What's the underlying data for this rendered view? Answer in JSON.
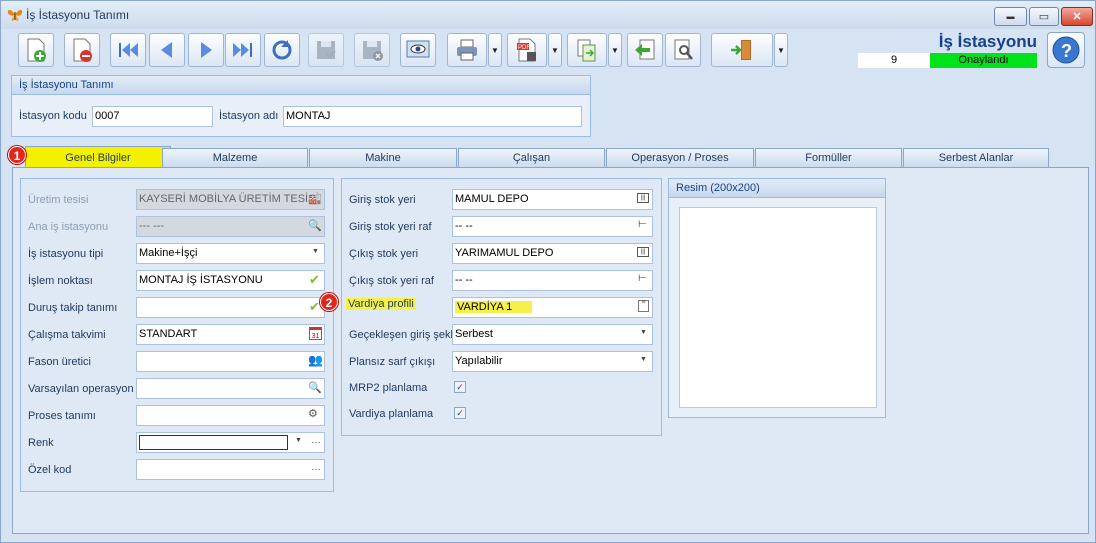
{
  "window": {
    "title": "İş İstasyonu Tanımı",
    "controls": {
      "minimize": "▬",
      "maximize": "▭",
      "close": "✕"
    }
  },
  "header": {
    "title": "İş İstasyonu Tanımı",
    "record_number": "9",
    "status": "Onaylandı",
    "status_color": "#00e21a"
  },
  "toolbar": {
    "icons": [
      "new-record-icon",
      "delete-record-icon",
      "first-record-icon",
      "previous-record-icon",
      "next-record-icon",
      "last-record-icon",
      "refresh-icon",
      "save-icon",
      "save-cancel-icon",
      "preview-icon",
      "print-icon",
      "pdf-export-icon",
      "export-icon",
      "back-icon",
      "tools-icon",
      "exit-icon"
    ]
  },
  "station": {
    "group_title": "İş İstasyonu Tanımı",
    "code_label": "İstasyon kodu",
    "code_value": "0007",
    "name_label": "İstasyon adı",
    "name_value": "MONTAJ"
  },
  "tabs": [
    {
      "label": "Genel Bilgiler",
      "active": true
    },
    {
      "label": "Malzeme"
    },
    {
      "label": "Makine"
    },
    {
      "label": "Çalışan"
    },
    {
      "label": "Operasyon / Proses"
    },
    {
      "label": "Formüller"
    },
    {
      "label": "Serbest Alanlar"
    }
  ],
  "badges": {
    "one": "1",
    "two": "2"
  },
  "left_panel": {
    "uretim_tesisi": {
      "label": "Üretim tesisi",
      "value": "KAYSERİ MOBİLYA ÜRETİM TESİSİ"
    },
    "ana_is_istasyonu": {
      "label": "Ana iş istasyonu",
      "value": "--- ---"
    },
    "is_istasyonu_tipi": {
      "label": "İş istasyonu tipi",
      "value": "Makine+İşçi"
    },
    "islem_noktasi": {
      "label": "İşlem noktası",
      "value": "MONTAJ İŞ İSTASYONU"
    },
    "durus_takip": {
      "label": "Duruş takip tanımı",
      "value": ""
    },
    "calisma_takvimi": {
      "label": "Çalışma takvimi",
      "value": "STANDART"
    },
    "fason_uretici": {
      "label": "Fason üretici",
      "value": ""
    },
    "varsayilan_operasyon": {
      "label": "Varsayılan operasyon",
      "value": ""
    },
    "proses_tanimi": {
      "label": "Proses tanımı",
      "value": ""
    },
    "renk": {
      "label": "Renk",
      "value": ""
    },
    "ozel_kod": {
      "label": "Özel kod",
      "value": ""
    }
  },
  "mid_panel": {
    "giris_stok_yeri": {
      "label": "Giriş stok yeri",
      "value": "MAMUL DEPO"
    },
    "giris_stok_yeri_raf": {
      "label": "Giriş stok yeri raf",
      "value": "-- --"
    },
    "cikis_stok_yeri": {
      "label": "Çıkış stok yeri",
      "value": "YARIMAMUL DEPO"
    },
    "cikis_stok_yeri_raf": {
      "label": "Çıkış stok yeri raf",
      "value": "-- --"
    },
    "vardiya_profili": {
      "label": "Vardiya profili",
      "value": "VARDİYA 1"
    },
    "geceklesen_giris": {
      "label": "Geçekleşen giriş şekli",
      "value": "Serbest"
    },
    "plansiz_sarf": {
      "label": "Plansız sarf çıkışı",
      "value": "Yapılabilir"
    },
    "mrp2": {
      "label": "MRP2 planlama",
      "checked": true
    },
    "vardiya_planlama": {
      "label": "Vardiya planlama",
      "checked": true
    }
  },
  "image_panel": {
    "title": "Resim (200x200)"
  },
  "highlight_color": "#f5f04a"
}
